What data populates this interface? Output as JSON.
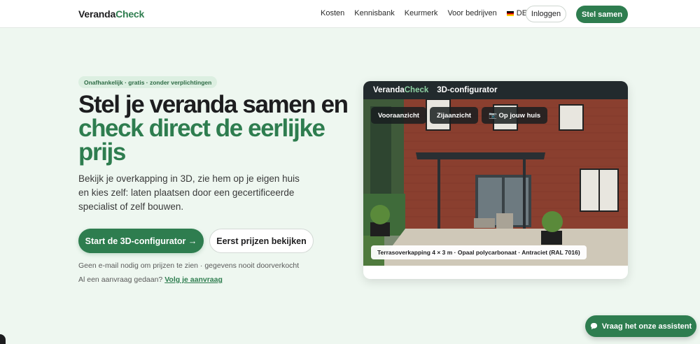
{
  "header": {
    "logo_a": "Veranda",
    "logo_b": "Check",
    "nav": [
      "Kosten",
      "Kennisbank",
      "Keurmerk",
      "Voor bedrijven"
    ],
    "lang": "DE",
    "login": "Inloggen",
    "cta": "Stel samen"
  },
  "hero": {
    "badge": "Onafhankelijk · gratis · zonder verplichtingen",
    "title_dark": "Stel je veranda samen en",
    "title_green_1": "check direct de eerlijke",
    "title_green_2": "prijs",
    "lead": "Bekijk je overkapping in 3D, zie hem op je eigen huis en kies zelf: laten plaatsen door een gecertificeerde specialist of zelf bouwen.",
    "primary": "Start de 3D-configurator →",
    "secondary": "Eerst prijzen bekijken",
    "note1": "Geen e-mail nodig om prijzen te zien · gegevens nooit doorverkocht",
    "note2_text": "Al een aanvraag gedaan?",
    "note2_link": "Volg je aanvraag"
  },
  "configurator": {
    "brand_a": "Veranda",
    "brand_b": "Check",
    "title": "3D-configurator",
    "tabs": [
      "Vooraanzicht",
      "Zijaanzicht",
      "📷 Op jouw huis"
    ],
    "caption": "Terrasoverkapping 4 × 3 m · Opaal polycarbonaat · Antraciet (RAL 7016)"
  },
  "chat": {
    "label": "Vraag het onze assistent"
  },
  "colors": {
    "brand_green": "#2e7d4f",
    "background": "#eef7f0"
  }
}
